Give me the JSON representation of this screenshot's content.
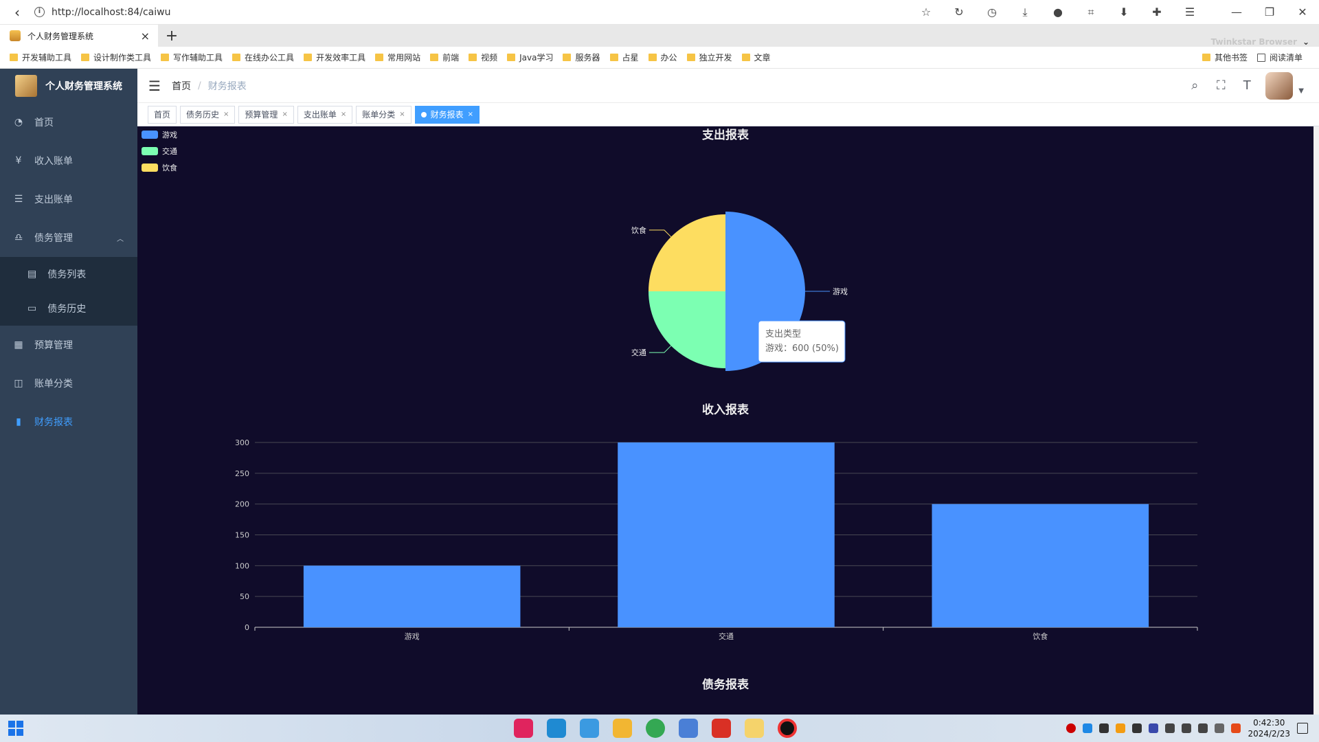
{
  "browser": {
    "url": "http://localhost:84/caiwu",
    "tab_title": "个人财务管理系统",
    "brand_text": "Twinkstar Browser",
    "bookmarks": [
      "开发辅助工具",
      "设计制作类工具",
      "写作辅助工具",
      "在线办公工具",
      "开发效率工具",
      "常用网站",
      "前端",
      "视频",
      "Java学习",
      "服务器",
      "占星",
      "办公",
      "独立开发",
      "文章"
    ],
    "bookmarks_right": [
      "其他书签",
      "阅读清单"
    ]
  },
  "sidebar": {
    "brand": "个人财务管理系统",
    "items": [
      {
        "label": "首页",
        "icon": "dashboard-icon"
      },
      {
        "label": "收入账单",
        "icon": "yen-icon"
      },
      {
        "label": "支出账单",
        "icon": "list-icon"
      },
      {
        "label": "债务管理",
        "icon": "debt-icon"
      },
      {
        "label": "预算管理",
        "icon": "budget-icon"
      },
      {
        "label": "账单分类",
        "icon": "category-icon"
      },
      {
        "label": "财务报表",
        "icon": "chart-bar-icon"
      }
    ],
    "sub_items": [
      {
        "label": "债务列表",
        "icon": "document-icon"
      },
      {
        "label": "债务历史",
        "icon": "history-icon"
      }
    ]
  },
  "header": {
    "breadcrumb_home": "首页",
    "breadcrumb_current": "财务报表"
  },
  "tags": [
    "首页",
    "债务历史",
    "预算管理",
    "支出账单",
    "账单分类",
    "财务报表"
  ],
  "charts_text": {
    "tooltip_title": "支出类型",
    "tooltip_value": "游戏：600 (50%)"
  },
  "chart_data": [
    {
      "type": "pie",
      "title": "支出报表",
      "categories": [
        "游戏",
        "交通",
        "饮食"
      ],
      "values": [
        600,
        300,
        300
      ],
      "legend": [
        "游戏",
        "交通",
        "饮食"
      ],
      "legend_position": "top-left",
      "colors": [
        "#4992ff",
        "#7cffb2",
        "#fddd60"
      ]
    },
    {
      "type": "bar",
      "title": "收入报表",
      "categories": [
        "游戏",
        "交通",
        "饮食"
      ],
      "values": [
        100,
        300,
        200
      ],
      "ylim": [
        0,
        300
      ],
      "yticks": [
        0,
        50,
        100,
        150,
        200,
        250,
        300
      ],
      "color": "#4992ff"
    },
    {
      "type": "bar",
      "title": "债务报表"
    }
  ],
  "taskbar": {
    "time": "0:42:30",
    "date": "2024/2/23"
  }
}
